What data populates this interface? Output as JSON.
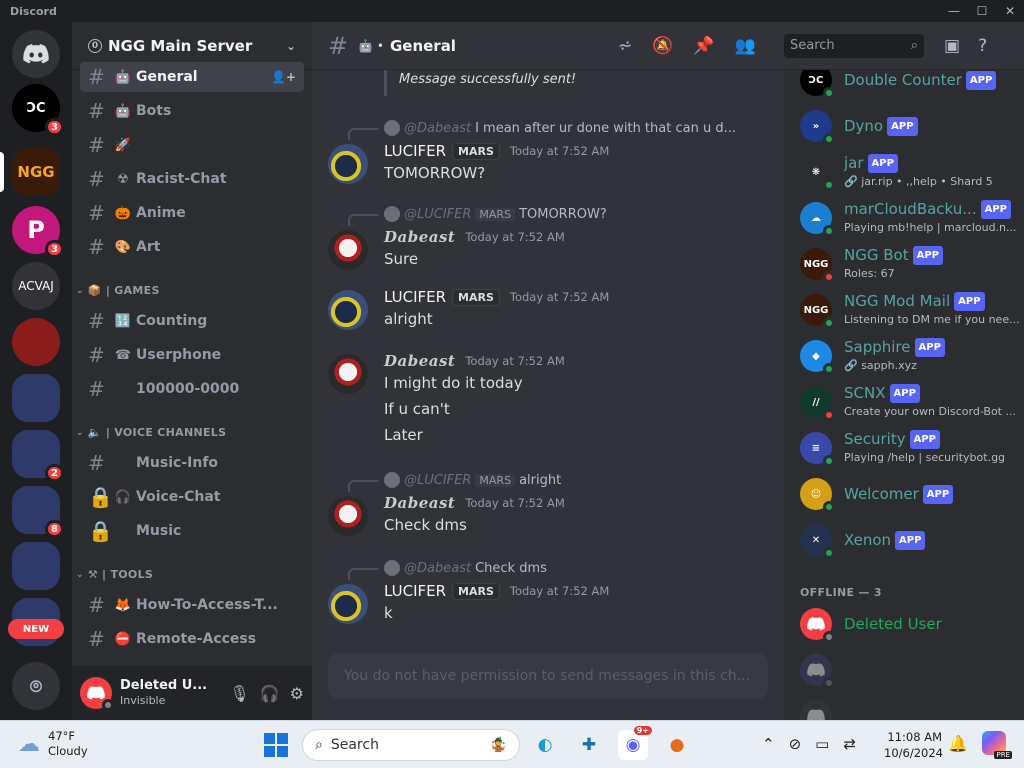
{
  "window": {
    "title": "Discord",
    "controls": [
      "—",
      "☐",
      "✕"
    ]
  },
  "servers": [
    {
      "label": "",
      "icon": "discord-home-icon",
      "color": "#313338",
      "badge": ""
    },
    {
      "label": "ƆC",
      "icon": "double-counter-server-icon",
      "color": "#000000",
      "badge": "3"
    },
    {
      "label": "NGG",
      "icon": "ngg-server-icon",
      "color": "#3a1a08",
      "badge": ""
    },
    {
      "label": "P",
      "icon": "p-server-icon",
      "color": "#c2187c",
      "badge": "3"
    },
    {
      "label": "ACVAJ",
      "icon": "acvaj-server-icon",
      "color": "#313338",
      "badge": ""
    },
    {
      "label": "",
      "icon": "red-server-icon",
      "color": "#8a1c1c",
      "badge": ""
    },
    {
      "label": "",
      "icon": "folder-server-icon",
      "color": "#2f3a6b",
      "badge": ""
    },
    {
      "label": "",
      "icon": "folder-server-icon",
      "color": "#2f3a6b",
      "badge": "2"
    },
    {
      "label": "",
      "icon": "folder-server-icon",
      "color": "#2f3a6b",
      "badge": "8"
    },
    {
      "label": "",
      "icon": "folder-server-icon",
      "color": "#2f3a6b",
      "badge": ""
    },
    {
      "label": "",
      "icon": "folder-server-icon",
      "color": "#2f3a6b",
      "badge": ""
    }
  ],
  "new_badge": "NEW",
  "server": {
    "name": "NGG Main Server",
    "boost": "0"
  },
  "channels": [
    {
      "name": "General",
      "emoji": "🤖",
      "active": true,
      "prefix": "#"
    },
    {
      "name": "Bots",
      "emoji": "🤖",
      "active": false,
      "prefix": "#"
    },
    {
      "name": "",
      "emoji": "🚀",
      "active": false,
      "prefix": "#"
    },
    {
      "name": "Racist-Chat",
      "emoji": "☢",
      "active": false,
      "prefix": "#"
    },
    {
      "name": "Anime",
      "emoji": "🎃",
      "active": false,
      "prefix": "#"
    },
    {
      "name": "Art",
      "emoji": "🎨",
      "active": false,
      "prefix": "#"
    }
  ],
  "categories": {
    "games": "| GAMES",
    "voice": "| VOICE CHANNELS",
    "tools": "| TOOLS"
  },
  "games_channels": [
    {
      "name": "Counting",
      "emoji": "🔢",
      "prefix": "#"
    },
    {
      "name": "Userphone",
      "emoji": "☎",
      "prefix": "#"
    },
    {
      "name": "100000-0000",
      "emoji": "",
      "prefix": "#"
    }
  ],
  "voice_channels": [
    {
      "name": "Music-Info",
      "emoji": "",
      "prefix": "#"
    },
    {
      "name": "Voice-Chat",
      "emoji": "🎧",
      "prefix": "🔒"
    },
    {
      "name": "Music",
      "emoji": "",
      "prefix": "🔒"
    }
  ],
  "tools_channels": [
    {
      "name": "How-To-Access-T...",
      "emoji": "🦊",
      "prefix": "#"
    },
    {
      "name": "Remote-Access",
      "emoji": "⛔",
      "prefix": "#"
    }
  ],
  "user": {
    "name": "Deleted U...",
    "status": "Invisible"
  },
  "topbar": {
    "channel": "General",
    "search_placeholder": "Search"
  },
  "system_message": "Message successfully sent!",
  "messages": [
    {
      "reply_name": "@Dabeast",
      "reply_tag": "",
      "reply_text": "I mean after ur done with that can u d...",
      "author": "LUCIFER",
      "tag": "MARS",
      "time": "Today at 7:52 AM",
      "lines": [
        "TOMORROW?"
      ],
      "avatar": "lucifer"
    },
    {
      "reply_name": "@LUCIFER",
      "reply_tag": "MARS",
      "reply_text": "TOMORROW?",
      "author": "Dabeast",
      "tag": "",
      "time": "Today at 7:52 AM",
      "lines": [
        "Sure"
      ],
      "avatar": "dabeast"
    },
    {
      "reply_name": "",
      "reply_tag": "",
      "reply_text": "",
      "author": "LUCIFER",
      "tag": "MARS",
      "time": "Today at 7:52 AM",
      "lines": [
        "alright"
      ],
      "avatar": "lucifer"
    },
    {
      "reply_name": "",
      "reply_tag": "",
      "reply_text": "",
      "author": "Dabeast",
      "tag": "",
      "time": "Today at 7:52 AM",
      "lines": [
        "I might do it today",
        "If u can't",
        "Later"
      ],
      "avatar": "dabeast"
    },
    {
      "reply_name": "@LUCIFER",
      "reply_tag": "MARS",
      "reply_text": "alright",
      "author": "Dabeast",
      "tag": "",
      "time": "Today at 7:52 AM",
      "lines": [
        "Check dms"
      ],
      "avatar": "dabeast"
    },
    {
      "reply_name": "@Dabeast",
      "reply_tag": "",
      "reply_text": "Check dms",
      "author": "LUCIFER",
      "tag": "MARS",
      "time": "Today at 7:52 AM",
      "lines": [
        "k"
      ],
      "avatar": "lucifer"
    }
  ],
  "composer_placeholder": "You do not have permission to send messages in this ch...",
  "members": [
    {
      "name": "Double Counter",
      "app": "APP",
      "sub": "",
      "color": "#000000",
      "label": "ƆC",
      "status": "#23a55a"
    },
    {
      "name": "Dyno",
      "app": "APP",
      "sub": "",
      "color": "#1f3a8a",
      "label": "»",
      "status": "#23a55a"
    },
    {
      "name": "jar",
      "app": "APP",
      "sub": "🔗 jar.rip • ,,help • Shard 5",
      "color": "#2b2d31",
      "label": "❋",
      "status": "#23a55a"
    },
    {
      "name": "marCloudBacku...",
      "app": "APP",
      "sub": "Playing mb!help | marcloud.n...",
      "color": "#1a7fd1",
      "label": "☁",
      "status": "#23a55a"
    },
    {
      "name": "NGG Bot",
      "app": "APP",
      "sub": "Roles: 67",
      "color": "#3a1a08",
      "label": "NGG",
      "status": "#f23f43"
    },
    {
      "name": "NGG Mod Mail",
      "app": "APP",
      "sub": "Listening to DM me if you nee...",
      "color": "#3a1a08",
      "label": "NGG",
      "status": "#23a55a"
    },
    {
      "name": "Sapphire",
      "app": "APP",
      "sub": "🔗 sapph.xyz",
      "color": "#1e88e5",
      "label": "◆",
      "status": "#23a55a"
    },
    {
      "name": "SCNX",
      "app": "APP",
      "sub": "Create your own Discord-Bot ...",
      "color": "#123a2a",
      "label": "//",
      "status": "#f23f43"
    },
    {
      "name": "Security",
      "app": "APP",
      "sub": "Playing /help | securitybot.gg",
      "color": "#3949ab",
      "label": "≡",
      "status": "#23a55a"
    },
    {
      "name": "Welcomer",
      "app": "APP",
      "sub": "",
      "color": "#d4a017",
      "label": "☺",
      "status": "#23a55a"
    },
    {
      "name": "Xenon",
      "app": "APP",
      "sub": "",
      "color": "#24324f",
      "label": "✕",
      "status": "#23a55a"
    }
  ],
  "offline_header": "OFFLINE — 3",
  "offline_members": [
    {
      "name": "Deleted User",
      "color": "#f23f43",
      "name_color": "#23a55a"
    },
    {
      "name": "",
      "color": "#3b4270",
      "name_color": "#6d6f78"
    },
    {
      "name": "",
      "color": "#3a3c42",
      "name_color": "#6d6f78"
    }
  ],
  "taskbar": {
    "temp": "47°F",
    "weather": "Cloudy",
    "search": "Search",
    "discord_badge": "9+",
    "time": "11:08 AM",
    "date": "10/6/2024",
    "pre": "PRE"
  }
}
